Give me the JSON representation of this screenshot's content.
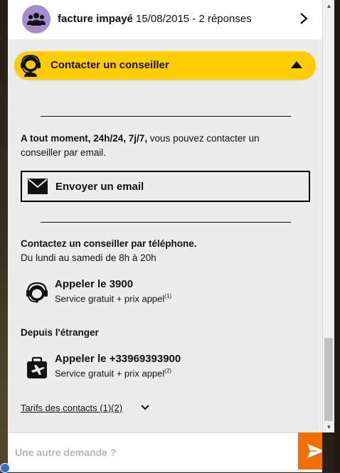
{
  "thread": {
    "title": "facture impayé",
    "meta": " 15/08/2015 - 2 réponses",
    "icon": "group-icon"
  },
  "section": {
    "title": "Contacter un conseiller",
    "expanded": true
  },
  "email": {
    "intro_bold": "A tout moment, 24h/24, 7j/7,",
    "intro_rest": " vous pouvez contacter un",
    "intro_line2": "conseiller par email.",
    "button_label": "Envoyer un email"
  },
  "phone": {
    "heading": "Contactez un conseiller par téléphone.",
    "hours": "Du lundi au samedi de 8h à 20h",
    "local": {
      "label": "Appeler le 3900",
      "sub": "Service gratuit + prix appel",
      "note": "(1)"
    },
    "abroad_heading": "Depuis l'étranger",
    "abroad": {
      "label": "Appeler le +33969393900",
      "sub": "Service gratuit + prix appel",
      "note": "(2)"
    }
  },
  "tarifs_link": "Tarifs des contacts (1)(2)",
  "composer": {
    "placeholder": "Une autre demande ?"
  },
  "colors": {
    "accent_yellow": "#ffcc00",
    "send_orange": "#f16e00",
    "avatar_purple": "#a58ccf"
  }
}
